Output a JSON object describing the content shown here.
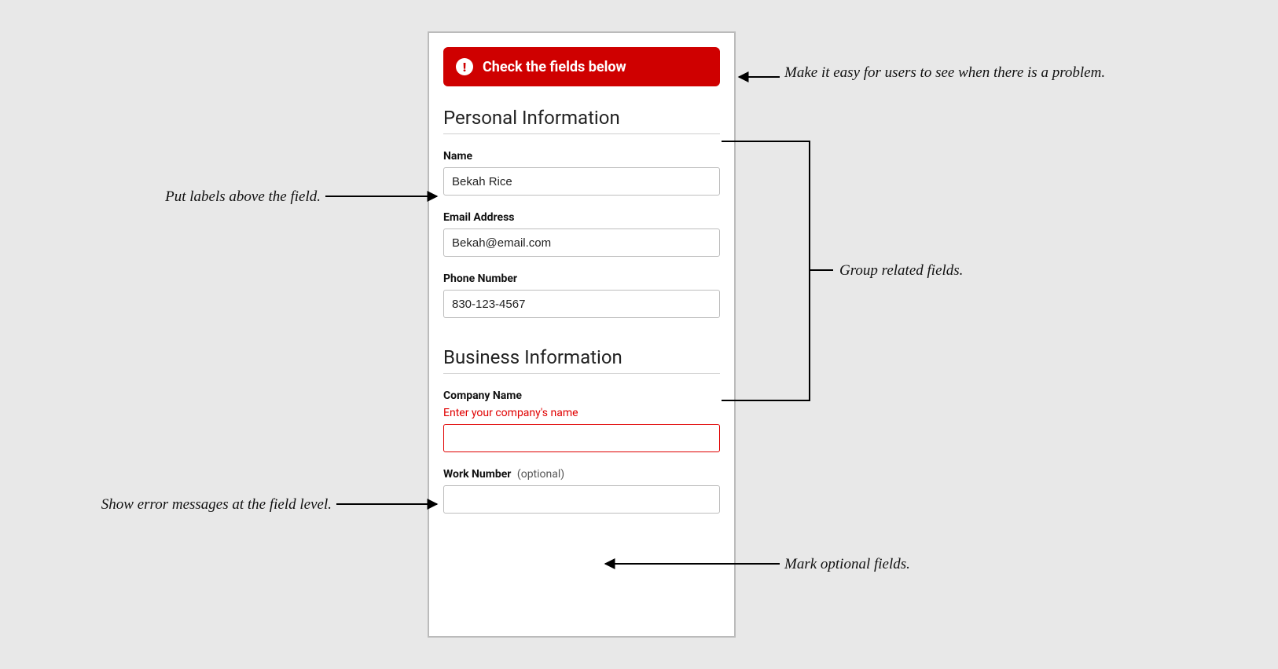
{
  "alert": {
    "text": "Check the fields below"
  },
  "sections": {
    "personal": {
      "heading": "Personal Information",
      "name_label": "Name",
      "name_value": "Bekah Rice",
      "email_label": "Email Address",
      "email_value": "Bekah@email.com",
      "phone_label": "Phone Number",
      "phone_value": "830-123-4567"
    },
    "business": {
      "heading": "Business Information",
      "company_label": "Company Name",
      "company_error": "Enter your company's name",
      "company_value": "",
      "work_label": "Work Number",
      "work_optional": "(optional)",
      "work_value": ""
    }
  },
  "annotations": {
    "alert_note": "Make it easy for users to see when there is a problem.",
    "labels_note": "Put labels above the field.",
    "group_note": "Group related fields.",
    "error_note": "Show error messages at the field level.",
    "optional_note": "Mark optional fields."
  }
}
